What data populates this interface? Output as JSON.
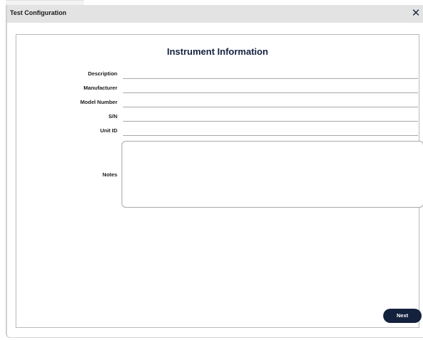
{
  "dialog": {
    "title": "Test Configuration",
    "close_glyph": "✕"
  },
  "panel": {
    "heading": "Instrument Information",
    "fields": [
      {
        "label": "Description",
        "value": ""
      },
      {
        "label": "Manufacturer",
        "value": ""
      },
      {
        "label": "Model Number",
        "value": ""
      },
      {
        "label": "S/N",
        "value": ""
      },
      {
        "label": "Unit ID",
        "value": ""
      }
    ],
    "notes": {
      "label": "Notes",
      "value": ""
    }
  },
  "footer": {
    "next_label": "Next"
  },
  "colors": {
    "accent": "#13213d",
    "titlebar": "#e3e3e3"
  }
}
